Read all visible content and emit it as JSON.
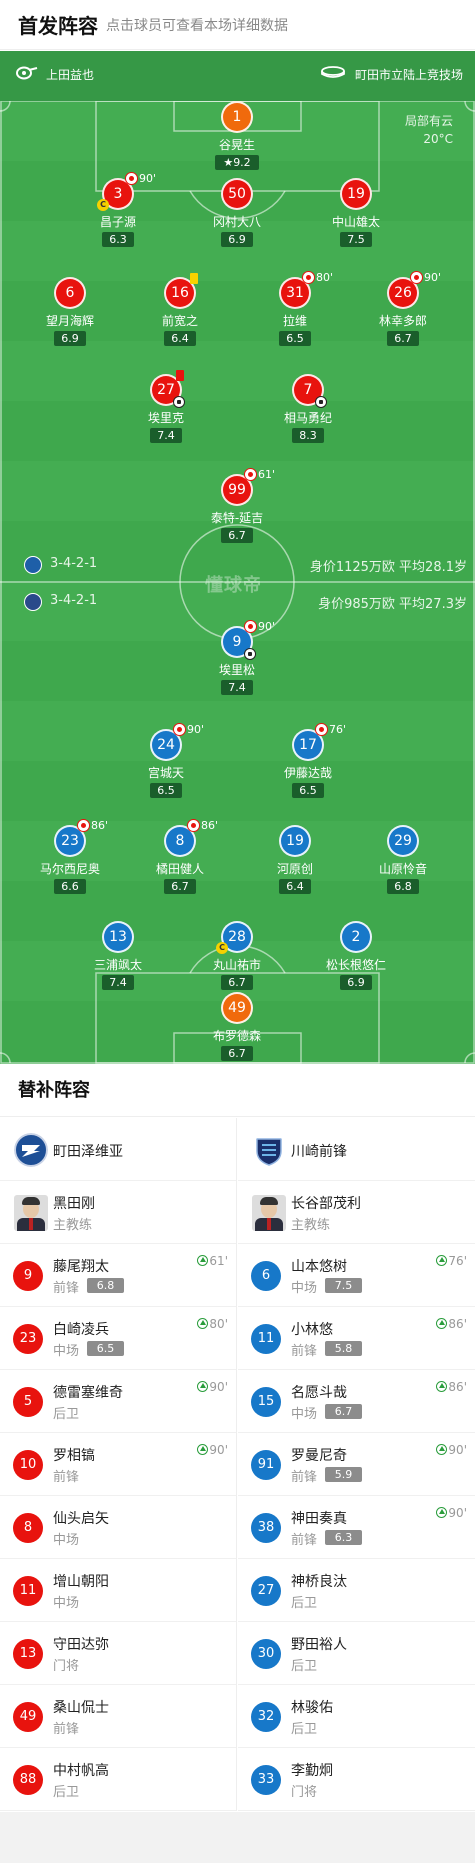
{
  "header": {
    "title": "首发阵容",
    "subtitle": "点击球员可查看本场详细数据"
  },
  "pitch_info": {
    "referee": "上田益也",
    "venue": "町田市立陆上竞技场",
    "weather": "局部有云",
    "temperature": "20°C",
    "watermark": "懂球帝"
  },
  "home_team": {
    "formation": "3-4-2-1",
    "value_age": "身价1125万欧  平均28.1岁",
    "color": "#e8130e"
  },
  "away_team": {
    "formation": "3-4-2-1",
    "value_age": "身价985万欧    平均27.3岁",
    "color": "#1778c9"
  },
  "home_players": [
    {
      "num": "1",
      "name": "谷晃生",
      "rating": "9.2"
    },
    {
      "num": "3",
      "name": "昌子源",
      "rating": "6.3",
      "sub": "90'"
    },
    {
      "num": "50",
      "name": "冈村大八",
      "rating": "6.9"
    },
    {
      "num": "19",
      "name": "中山雄太",
      "rating": "7.5"
    },
    {
      "num": "6",
      "name": "望月海辉",
      "rating": "6.9"
    },
    {
      "num": "16",
      "name": "前宽之",
      "rating": "6.4"
    },
    {
      "num": "31",
      "name": "拉维",
      "rating": "6.5",
      "sub": "80'"
    },
    {
      "num": "26",
      "name": "林幸多郎",
      "rating": "6.7",
      "sub": "90'"
    },
    {
      "num": "27",
      "name": "埃里克",
      "rating": "7.4"
    },
    {
      "num": "7",
      "name": "相马勇纪",
      "rating": "8.3"
    },
    {
      "num": "99",
      "name": "泰特-延吉",
      "rating": "6.7",
      "sub": "61'"
    }
  ],
  "away_players": [
    {
      "num": "9",
      "name": "埃里松",
      "rating": "7.4",
      "sub": "90'"
    },
    {
      "num": "24",
      "name": "宫城天",
      "rating": "6.5",
      "sub": "90'"
    },
    {
      "num": "17",
      "name": "伊藤达哉",
      "rating": "6.5",
      "sub": "76'"
    },
    {
      "num": "23",
      "name": "马尔西尼奥",
      "rating": "6.6",
      "sub": "86'"
    },
    {
      "num": "8",
      "name": "橘田健人",
      "rating": "6.7",
      "sub": "86'"
    },
    {
      "num": "19",
      "name": "河原创",
      "rating": "6.4"
    },
    {
      "num": "29",
      "name": "山原怜音",
      "rating": "6.8"
    },
    {
      "num": "13",
      "name": "三浦飒太",
      "rating": "7.4"
    },
    {
      "num": "28",
      "name": "丸山祐市",
      "rating": "6.7"
    },
    {
      "num": "2",
      "name": "松长根悠仁",
      "rating": "6.9"
    },
    {
      "num": "49",
      "name": "布罗德森",
      "rating": "6.7"
    }
  ],
  "subs": {
    "title": "替补阵容",
    "home": {
      "club": "町田泽维亚",
      "coach": {
        "name": "黑田刚",
        "role": "主教练"
      },
      "players": [
        {
          "num": "9",
          "name": "藤尾翔太",
          "pos": "前锋",
          "rating": "6.8",
          "in": "61'"
        },
        {
          "num": "23",
          "name": "白崎凌兵",
          "pos": "中场",
          "rating": "6.5",
          "in": "80'"
        },
        {
          "num": "5",
          "name": "德雷塞维奇",
          "pos": "后卫",
          "in": "90'"
        },
        {
          "num": "10",
          "name": "罗相镐",
          "pos": "前锋",
          "in": "90'"
        },
        {
          "num": "8",
          "name": "仙头启矢",
          "pos": "中场"
        },
        {
          "num": "11",
          "name": "增山朝阳",
          "pos": "中场"
        },
        {
          "num": "13",
          "name": "守田达弥",
          "pos": "门将"
        },
        {
          "num": "49",
          "name": "桑山侃士",
          "pos": "前锋"
        },
        {
          "num": "88",
          "name": "中村帆高",
          "pos": "后卫"
        }
      ]
    },
    "away": {
      "club": "川崎前锋",
      "coach": {
        "name": "长谷部茂利",
        "role": "主教练"
      },
      "players": [
        {
          "num": "6",
          "name": "山本悠树",
          "pos": "中场",
          "rating": "7.5",
          "in": "76'"
        },
        {
          "num": "11",
          "name": "小林悠",
          "pos": "前锋",
          "rating": "5.8",
          "in": "86'"
        },
        {
          "num": "15",
          "name": "名愿斗哉",
          "pos": "中场",
          "rating": "6.7",
          "in": "86'"
        },
        {
          "num": "91",
          "name": "罗曼尼奇",
          "pos": "前锋",
          "rating": "5.9",
          "in": "90'"
        },
        {
          "num": "38",
          "name": "神田奏真",
          "pos": "前锋",
          "rating": "6.3",
          "in": "90'"
        },
        {
          "num": "27",
          "name": "神桥良汰",
          "pos": "后卫"
        },
        {
          "num": "30",
          "name": "野田裕人",
          "pos": "后卫"
        },
        {
          "num": "32",
          "name": "林骏佑",
          "pos": "后卫"
        },
        {
          "num": "33",
          "name": "李勤炯",
          "pos": "门将"
        }
      ]
    }
  }
}
